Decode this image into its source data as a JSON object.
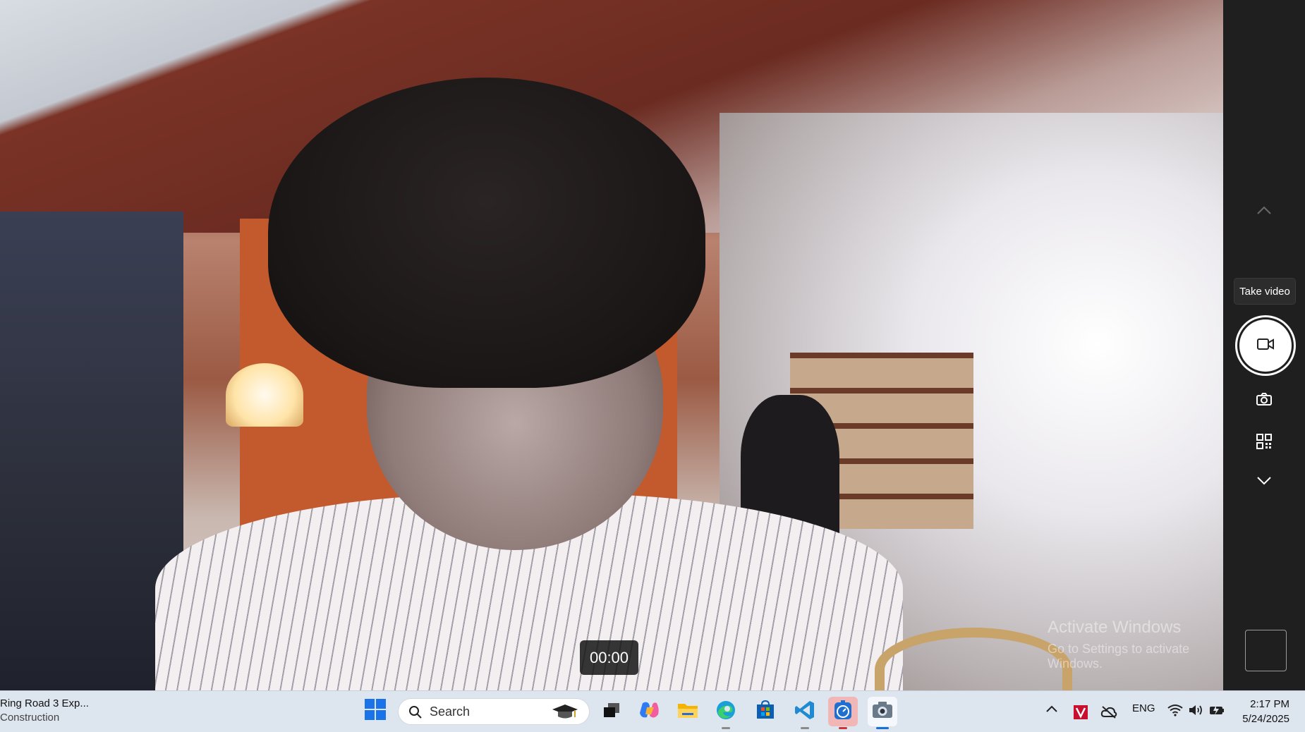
{
  "camera": {
    "timer": "00:00",
    "tooltip": "Take video",
    "watermark_title": "Activate Windows",
    "watermark_sub": "Go to Settings to activate Windows."
  },
  "sidebar": {
    "icons": [
      "chevron-up-icon",
      "video-icon",
      "camera-icon",
      "qr-code-icon",
      "chevron-down-icon"
    ]
  },
  "taskbar": {
    "weather_line1": "Ring Road 3 Exp...",
    "weather_line2": "Construction",
    "search_placeholder": "Search",
    "tray_lang": "ENG",
    "time": "2:17 PM",
    "date": "5/24/2025"
  },
  "colors": {
    "taskbar_bg": "#dde5ee",
    "sidebar_bg": "#1f1f1f",
    "record_red": "#d13438"
  }
}
